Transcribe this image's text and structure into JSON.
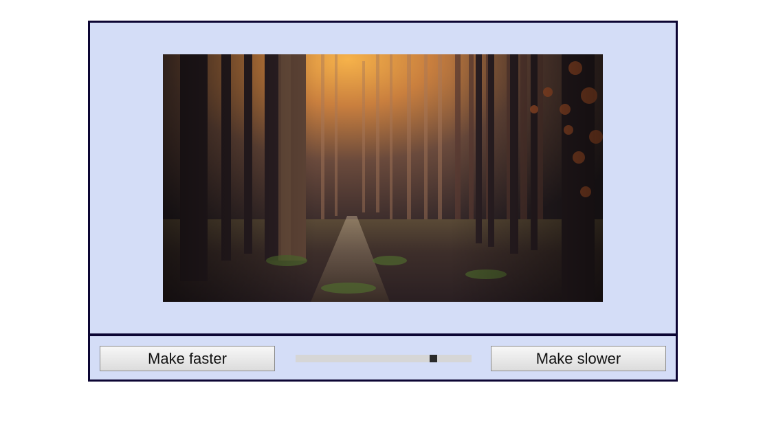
{
  "player": {
    "image_icon": "forest-photo",
    "faster_label": "Make faster",
    "slower_label": "Make slower",
    "speed_fraction": 0.78
  },
  "colors": {
    "panel_bg": "#d4ddf7",
    "border": "#0c0533",
    "slider_track": "#d6d6d6",
    "slider_thumb": "#2a2a2a"
  }
}
